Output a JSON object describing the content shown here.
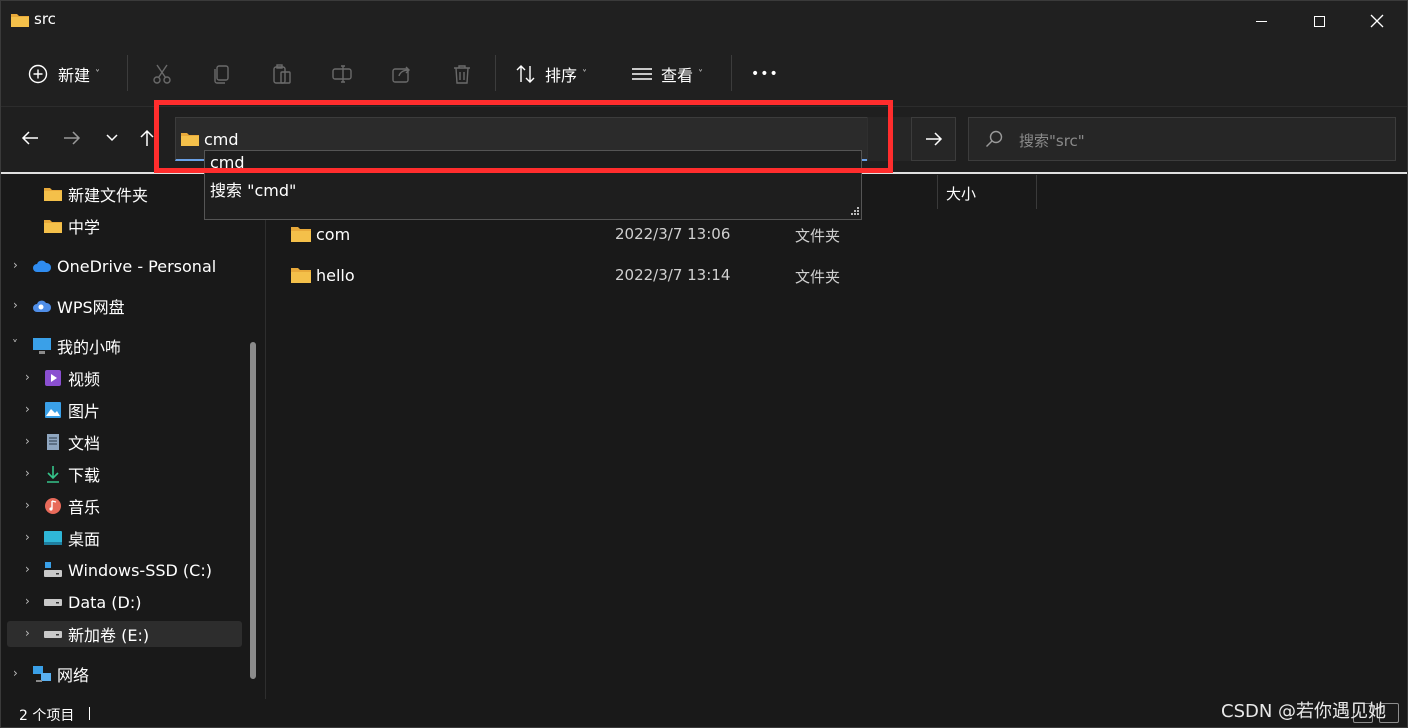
{
  "window": {
    "title": "src"
  },
  "toolbar": {
    "new_label": "新建",
    "sort_label": "排序",
    "view_label": "查看",
    "more_label": "•••"
  },
  "address": {
    "value": "cmd"
  },
  "search": {
    "placeholder": "搜索\"src\""
  },
  "suggestions": [
    "cmd",
    "搜索 \"cmd\""
  ],
  "sidebar": {
    "items": [
      {
        "label": "新建文件夹"
      },
      {
        "label": "中学"
      },
      {
        "label": "OneDrive - Personal"
      },
      {
        "label": "WPS网盘"
      },
      {
        "label": "我的小咘"
      },
      {
        "label": "视频"
      },
      {
        "label": "图片"
      },
      {
        "label": "文档"
      },
      {
        "label": "下载"
      },
      {
        "label": "音乐"
      },
      {
        "label": "桌面"
      },
      {
        "label": "Windows-SSD (C:)"
      },
      {
        "label": "Data (D:)"
      },
      {
        "label": "新加卷 (E:)"
      },
      {
        "label": "网络"
      }
    ]
  },
  "columns": {
    "size": "大小"
  },
  "files": [
    {
      "name": "com",
      "date": "2022/3/7 13:06",
      "type": "文件夹"
    },
    {
      "name": "hello",
      "date": "2022/3/7 13:14",
      "type": "文件夹"
    }
  ],
  "status": {
    "count": "2 个项目"
  },
  "watermark": "CSDN @若你遇见她",
  "colors": {
    "accent": "#6aa0e6",
    "highlight": "#ff2d2d",
    "folder": "#f4c04a"
  }
}
